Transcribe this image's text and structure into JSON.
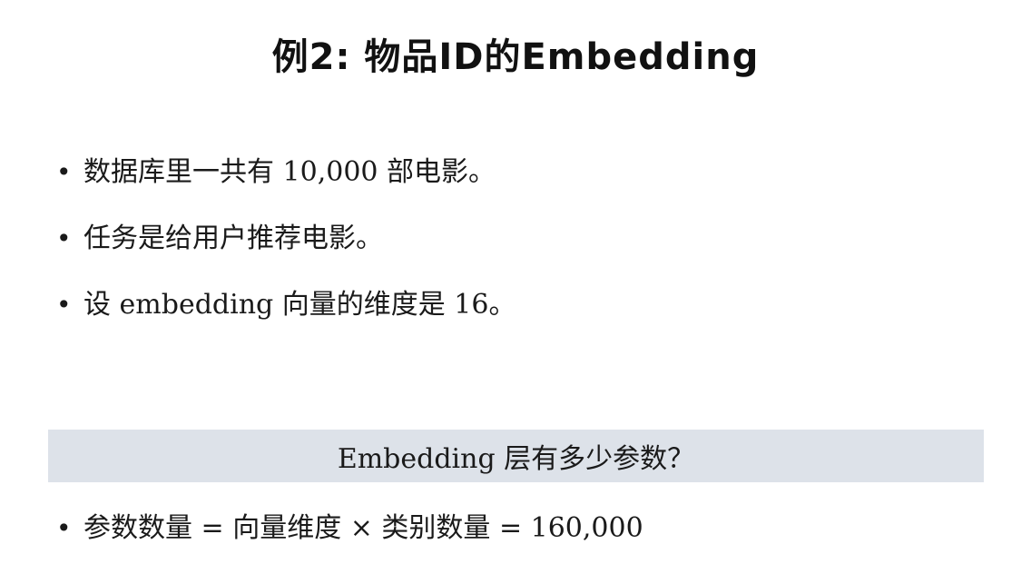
{
  "slide": {
    "title": "例2:  物品ID的Embedding",
    "bullets": [
      "数据库里一共有 10,000 部电影。",
      "任务是给用户推荐电影。",
      "设 embedding 向量的维度是 16。"
    ],
    "question": "Embedding 层有多少参数？",
    "answer": "参数数量 = 向量维度 × 类别数量 = 160,000",
    "bullet_symbol": "•"
  }
}
